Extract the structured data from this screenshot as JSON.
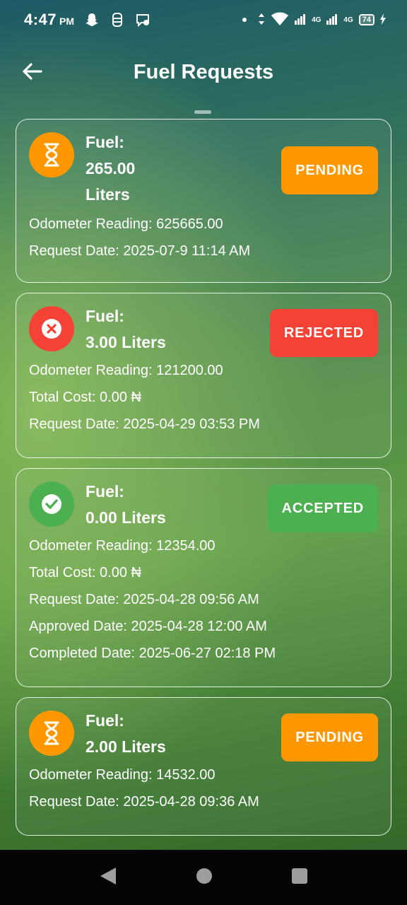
{
  "status_bar": {
    "time": "4:47",
    "ampm": "PM",
    "network_1": "4G",
    "network_2": "4G",
    "battery": "74"
  },
  "header": {
    "title": "Fuel Requests"
  },
  "colors": {
    "pending": "#ff9800",
    "rejected": "#f44336",
    "accepted": "#4caf50"
  },
  "requests": [
    {
      "status": "PENDING",
      "icon": "hourglass-icon",
      "fuel_label": "Fuel:",
      "fuel_line1": "265.00",
      "fuel_line2": "Liters",
      "odometer": "Odometer Reading: 625665.00",
      "request_date": "Request Date: 2025-07-9 11:14 AM"
    },
    {
      "status": "REJECTED",
      "icon": "close-circle-icon",
      "fuel_label": "Fuel:",
      "fuel_line1": "3.00 Liters",
      "odometer": "Odometer Reading: 121200.00",
      "total_cost": "Total Cost: 0.00 ₦",
      "request_date": "Request Date: 2025-04-29 03:53 PM"
    },
    {
      "status": "ACCEPTED",
      "icon": "check-circle-icon",
      "fuel_label": "Fuel:",
      "fuel_line1": "0.00 Liters",
      "odometer": "Odometer Reading: 12354.00",
      "total_cost": "Total Cost: 0.00 ₦",
      "request_date": "Request Date: 2025-04-28 09:56 AM",
      "approved_date": "Approved Date: 2025-04-28 12:00 AM",
      "completed_date": "Completed Date: 2025-06-27 02:18 PM"
    },
    {
      "status": "PENDING",
      "icon": "hourglass-icon",
      "fuel_label": "Fuel:",
      "fuel_line1": "2.00 Liters",
      "odometer": "Odometer Reading: 14532.00",
      "request_date": "Request Date: 2025-04-28 09:36 AM"
    }
  ]
}
